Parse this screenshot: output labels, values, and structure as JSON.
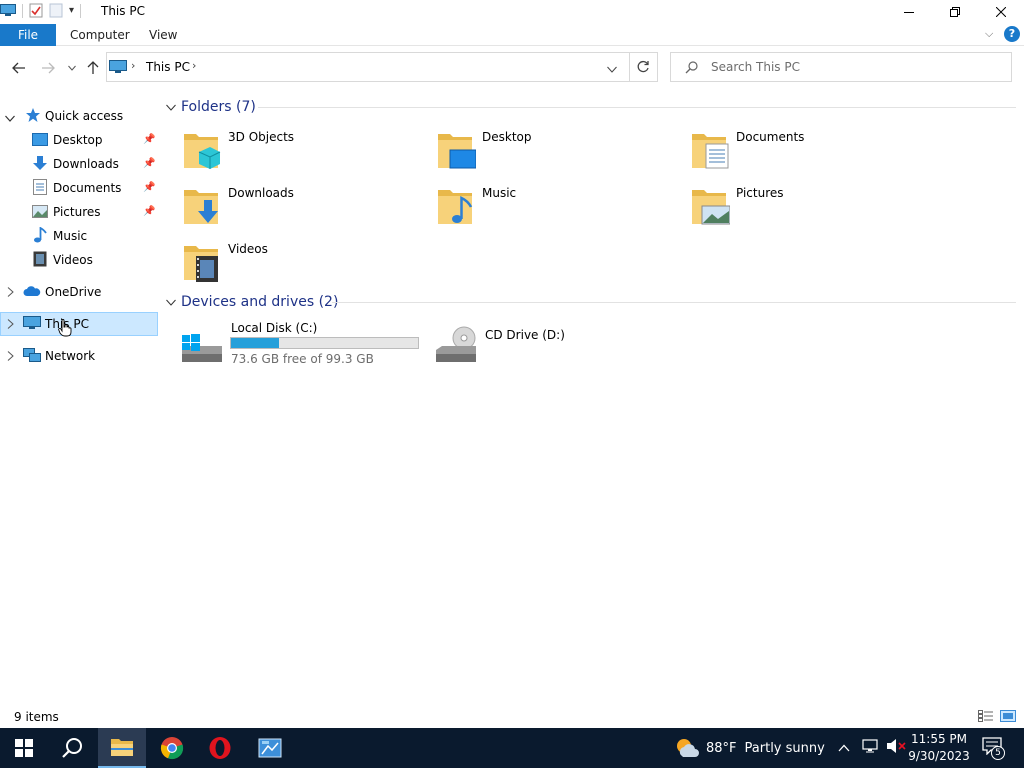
{
  "window": {
    "title": "This PC"
  },
  "ribbon": {
    "tabs": [
      "File",
      "Computer",
      "View"
    ]
  },
  "address": {
    "location": "This PC",
    "search_placeholder": "Search This PC"
  },
  "nav": {
    "quick_access": "Quick access",
    "quick_items": [
      "Desktop",
      "Downloads",
      "Documents",
      "Pictures",
      "Music",
      "Videos"
    ],
    "onedrive": "OneDrive",
    "this_pc": "This PC",
    "network": "Network"
  },
  "content": {
    "folders_header": "Folders (7)",
    "folders": [
      "3D Objects",
      "Desktop",
      "Documents",
      "Downloads",
      "Music",
      "Pictures",
      "Videos"
    ],
    "drives_header": "Devices and drives (2)",
    "drives": [
      {
        "name": "Local Disk (C:)",
        "free_text": "73.6 GB free of 99.3 GB",
        "used_fraction": 0.259
      },
      {
        "name": "CD Drive (D:)"
      }
    ]
  },
  "status": {
    "items": "9 items"
  },
  "taskbar": {
    "weather_temp": "88°F",
    "weather_desc": "Partly sunny",
    "time": "11:55 PM",
    "date": "9/30/2023",
    "notifications": "5"
  },
  "colors": {
    "accent": "#1979ca",
    "selection": "#cce8ff",
    "group_header": "#1e3287",
    "drive_bar": "#26a0da",
    "taskbar": "#0a1a2e"
  }
}
